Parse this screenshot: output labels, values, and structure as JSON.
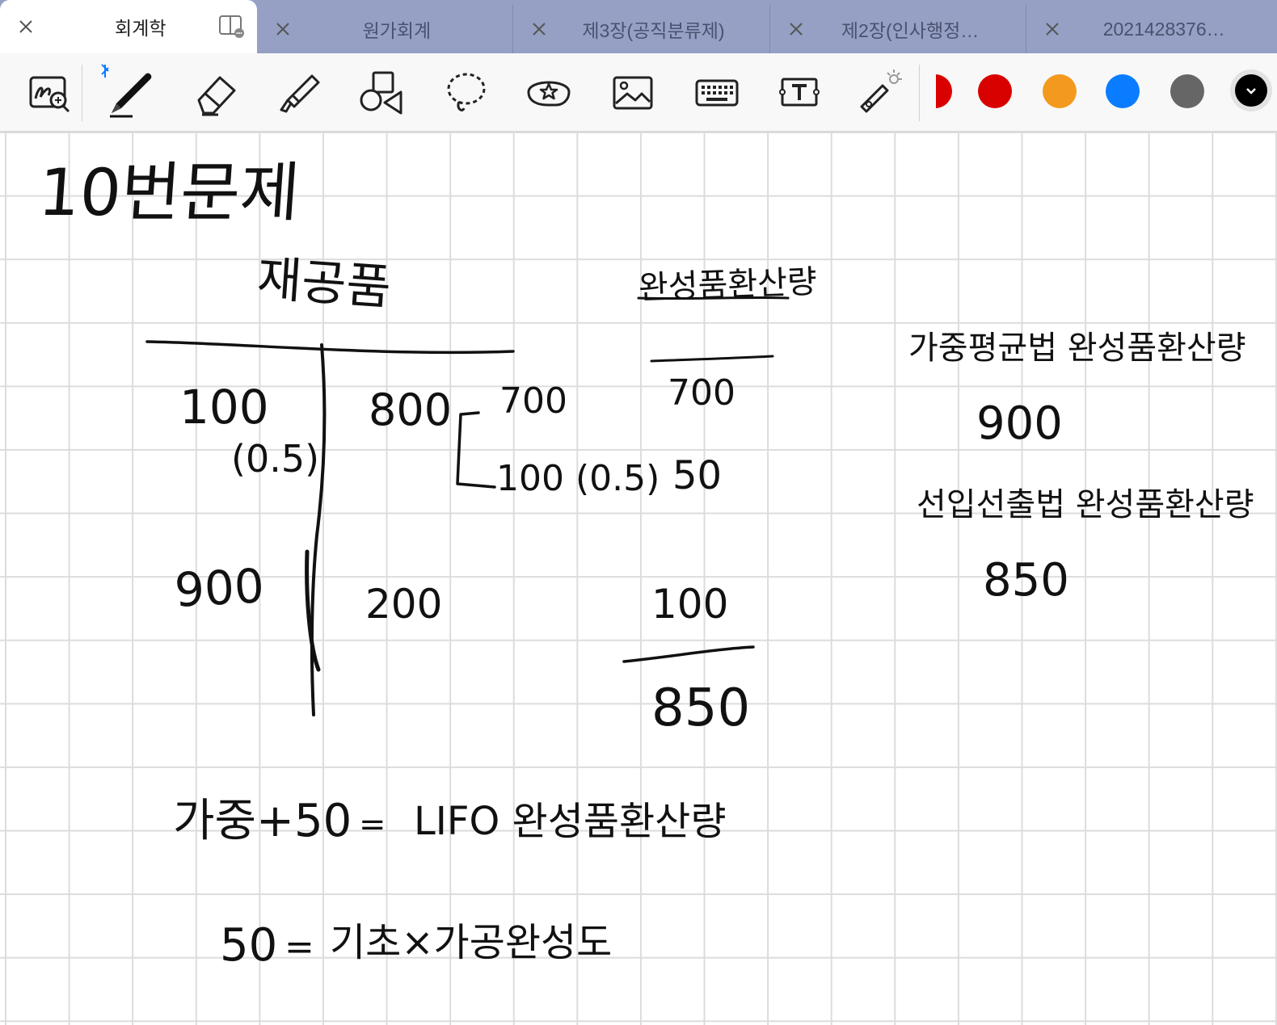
{
  "tabs": [
    {
      "label": "회계학",
      "active": true
    },
    {
      "label": "원가회계",
      "active": false
    },
    {
      "label": "제3장(공직분류제)",
      "active": false
    },
    {
      "label": "제2장(인사행정…",
      "active": false
    },
    {
      "label": "2021428376…",
      "active": false
    }
  ],
  "toolbar": {
    "tools": [
      "zoom-lasso-icon",
      "pen-icon",
      "eraser-icon",
      "highlighter-icon",
      "shapes-icon",
      "lasso-icon",
      "sticker-icon",
      "image-icon",
      "keyboard-icon",
      "text-box-icon",
      "laser-pointer-icon"
    ],
    "colors": [
      "#d90000",
      "#f39a1e",
      "#0a7cff",
      "#666666",
      "#000000"
    ]
  },
  "note": {
    "title": "10번문제",
    "t_account_title": "재공품",
    "left_col": [
      "100",
      "(0.5)",
      "900"
    ],
    "right_col": [
      "800",
      "200"
    ],
    "bracket_top": "700",
    "bracket_bottom": "100 (0.5)",
    "equiv_title": "완성품환산량",
    "equiv_values": [
      "700",
      "50",
      "100",
      "850"
    ],
    "weighted_avg_label": "가중평균법 완성품환산량",
    "weighted_avg_value": "900",
    "fifo_label": "선입선출법 완성품환산량",
    "fifo_value": "850",
    "eq1_left": "가중+50",
    "eq1_eq": "=",
    "eq1_right": "LIFO 완성품환산량",
    "eq2_left": "50",
    "eq2_eq": "=",
    "eq2_right": "기초×가공완성도"
  }
}
